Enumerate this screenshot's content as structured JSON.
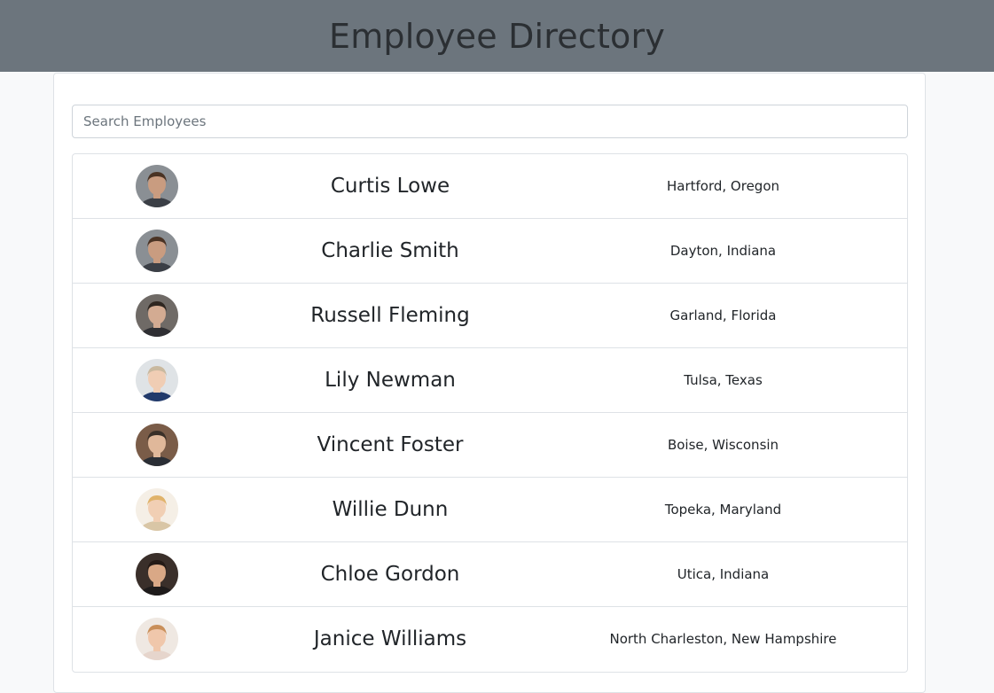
{
  "header": {
    "title": "Employee Directory"
  },
  "search": {
    "placeholder": "Search Employees",
    "value": ""
  },
  "employees": [
    {
      "name": "Curtis Lowe",
      "location": "Hartford, Oregon",
      "avatar": {
        "skin": "#c99c80",
        "hair": "#4a3324",
        "bg": "#8a8f94",
        "shirt": "#3b3f46"
      }
    },
    {
      "name": "Charlie Smith",
      "location": "Dayton, Indiana",
      "avatar": {
        "skin": "#c99c80",
        "hair": "#4a3324",
        "bg": "#8a8f94",
        "shirt": "#3b3f46"
      }
    },
    {
      "name": "Russell Fleming",
      "location": "Garland, Florida",
      "avatar": {
        "skin": "#d3ab92",
        "hair": "#2e2620",
        "bg": "#6f6a66",
        "shirt": "#2f2f33"
      }
    },
    {
      "name": "Lily Newman",
      "location": "Tulsa, Texas",
      "avatar": {
        "skin": "#f0cdb4",
        "hair": "#c9b99f",
        "bg": "#dfe3e6",
        "shirt": "#223a6b"
      }
    },
    {
      "name": "Vincent Foster",
      "location": "Boise, Wisconsin",
      "avatar": {
        "skin": "#e0b89a",
        "hair": "#3a3028",
        "bg": "#7a5c48",
        "shirt": "#2a2e35"
      }
    },
    {
      "name": "Willie Dunn",
      "location": "Topeka, Maryland",
      "avatar": {
        "skin": "#f1cfb4",
        "hair": "#e0b36a",
        "bg": "#f5efe6",
        "shirt": "#d9c6a6"
      }
    },
    {
      "name": "Chloe Gordon",
      "location": "Utica, Indiana",
      "avatar": {
        "skin": "#d9a886",
        "hair": "#241a16",
        "bg": "#3a2f2a",
        "shirt": "#1e1b1b"
      }
    },
    {
      "name": "Janice Williams",
      "location": "North Charleston, New Hampshire",
      "avatar": {
        "skin": "#f0c7ab",
        "hair": "#c98f5a",
        "bg": "#efe8e2",
        "shirt": "#e6d5cc"
      }
    }
  ]
}
